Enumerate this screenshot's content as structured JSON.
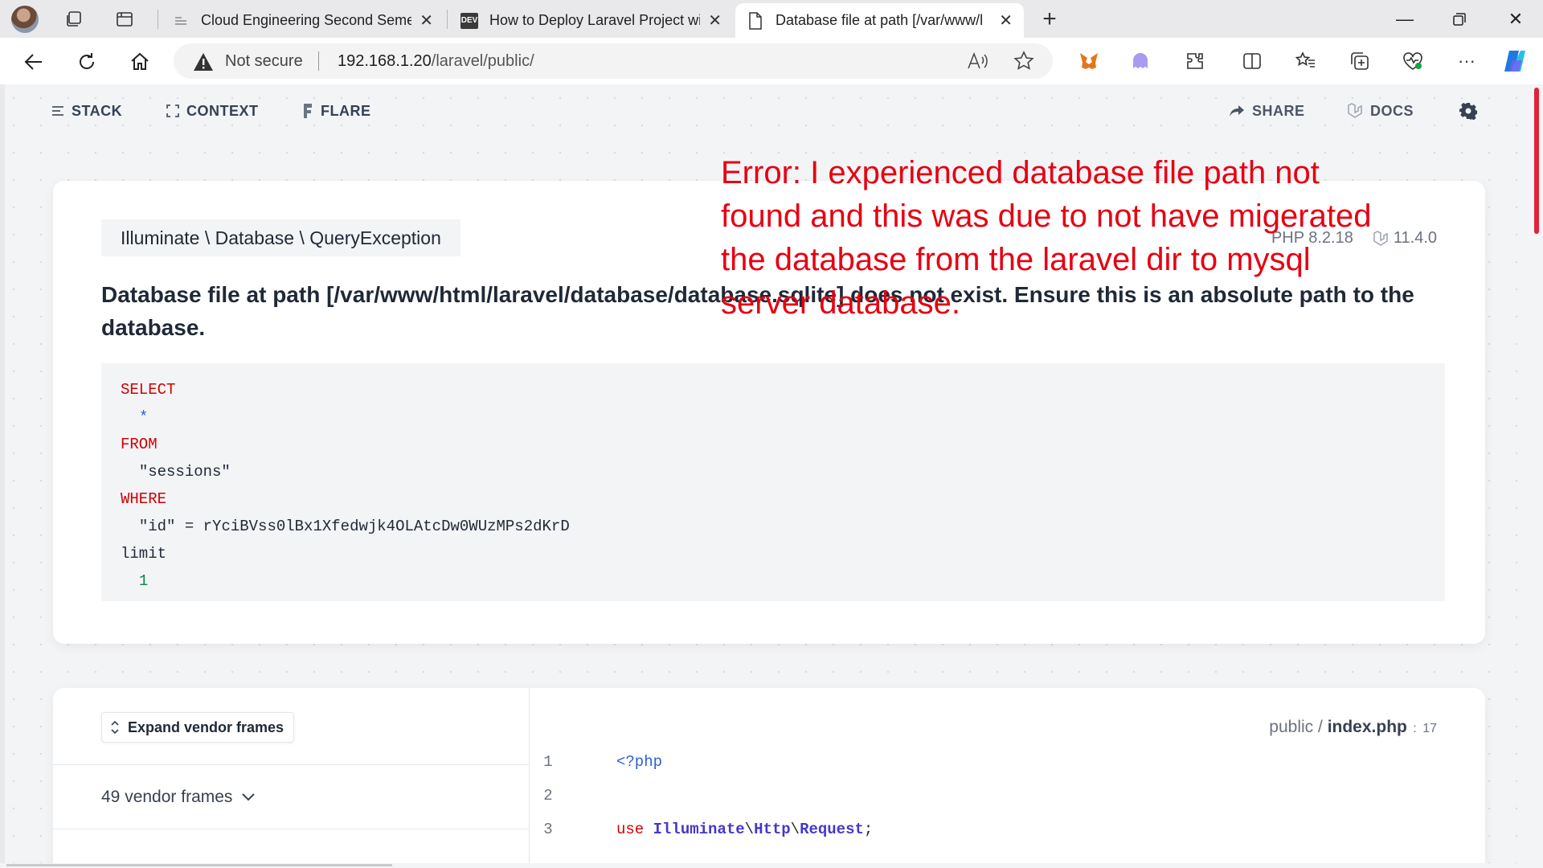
{
  "browser": {
    "tabs": [
      {
        "title": "Cloud Engineering Second Seme",
        "favicon": "doc-lines-icon"
      },
      {
        "title": "How to Deploy Laravel Project wi",
        "favicon": "DEV"
      },
      {
        "title": "Database file at path [/var/www/l",
        "favicon": "page-icon",
        "active": true
      }
    ],
    "address": {
      "security": "Not secure",
      "host": "192.168.1.20",
      "path": "/laravel/public/"
    }
  },
  "nav": {
    "stack": "STACK",
    "context": "CONTEXT",
    "flare": "FLARE",
    "share": "SHARE",
    "docs": "DOCS"
  },
  "exception": {
    "class": "Illuminate \\ Database \\ QueryException",
    "php_version": "PHP 8.2.18",
    "laravel_version": "11.4.0",
    "message": "Database file at path [/var/www/html/laravel/database/database.sqlite] does not exist. Ensure this is an absolute path to the database.",
    "sql": {
      "select": "SELECT",
      "star": "*",
      "from": "FROM",
      "table": "\"sessions\"",
      "where": "WHERE",
      "column": "\"id\"",
      "equals": "=",
      "value": "rYciBVss0lBx1Xfedwjk4OLAtcDw0WUzMPs2dKrD",
      "limit": "limit",
      "limit_value": "1"
    }
  },
  "stack": {
    "expand_label": "Expand vendor frames",
    "vendor_frames": "49 vendor frames",
    "file_dir": "public",
    "file_sep": " / ",
    "file_name": "index.php",
    "line_sep": " : ",
    "line_number": "17",
    "code": [
      {
        "n": "1",
        "php_open": "<?php"
      },
      {
        "n": "2"
      },
      {
        "n": "3",
        "use": "use",
        "ns1": "Illuminate",
        "bs1": "\\",
        "ns2": "Http",
        "bs2": "\\",
        "ns3": "Request",
        "semi": ";"
      }
    ]
  },
  "annotation": "Error: I experienced database file path not found and this was due to not have migerated the database from the laravel dir to mysql server database.",
  "colors": {
    "annotation": "#e60012",
    "sql_keyword": "#d20000",
    "sql_number": "#13844a",
    "php_tag": "#2d5fd8"
  }
}
